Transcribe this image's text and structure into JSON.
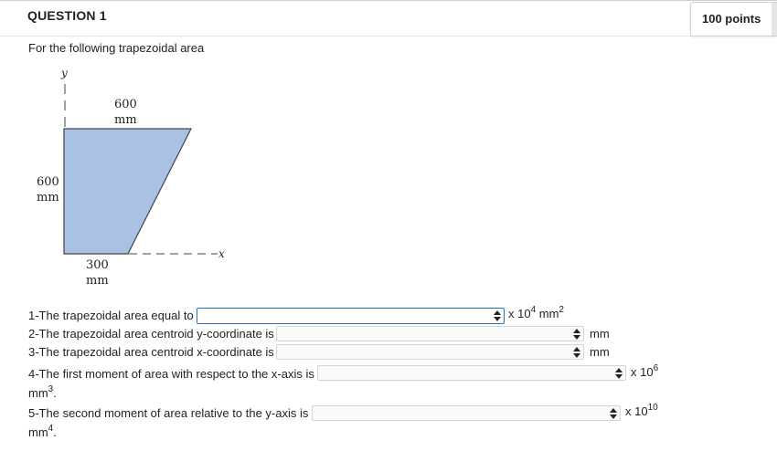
{
  "header": {
    "question_title": "QUESTION 1",
    "points": "100 points"
  },
  "intro": "For the following trapezoidal area",
  "figure": {
    "y_axis_label": "y",
    "x_axis_label": "x",
    "top_dim_value": "600",
    "top_dim_unit": "mm",
    "left_dim_value": "600",
    "left_dim_unit": "mm",
    "bottom_dim_value": "300",
    "bottom_dim_unit": "mm",
    "fill_color": "#a9c1e3"
  },
  "questions": [
    {
      "label": "1-The trapezoidal area equal to",
      "value": "",
      "unit_prefix": "x 10",
      "unit_exp": "4",
      "unit_suffix": " mm",
      "unit_suffix_exp": "2"
    },
    {
      "label": "2-The trapezoidal area centroid y-coordinate is",
      "value": "",
      "unit": "mm"
    },
    {
      "label": "3-The trapezoidal area centroid x-coordinate is",
      "value": "",
      "unit": "mm"
    },
    {
      "label": "4-The first moment of area with respect to the x-axis is",
      "value": "",
      "unit_prefix": "x 10",
      "unit_exp": "6",
      "cont": "mm",
      "cont_exp": "3",
      "cont_tail": "."
    },
    {
      "label": "5-The second moment of area relative to the y-axis is",
      "value": "",
      "unit_prefix": "x 10",
      "unit_exp": "10",
      "cont": "mm",
      "cont_exp": "4",
      "cont_tail": "."
    }
  ]
}
